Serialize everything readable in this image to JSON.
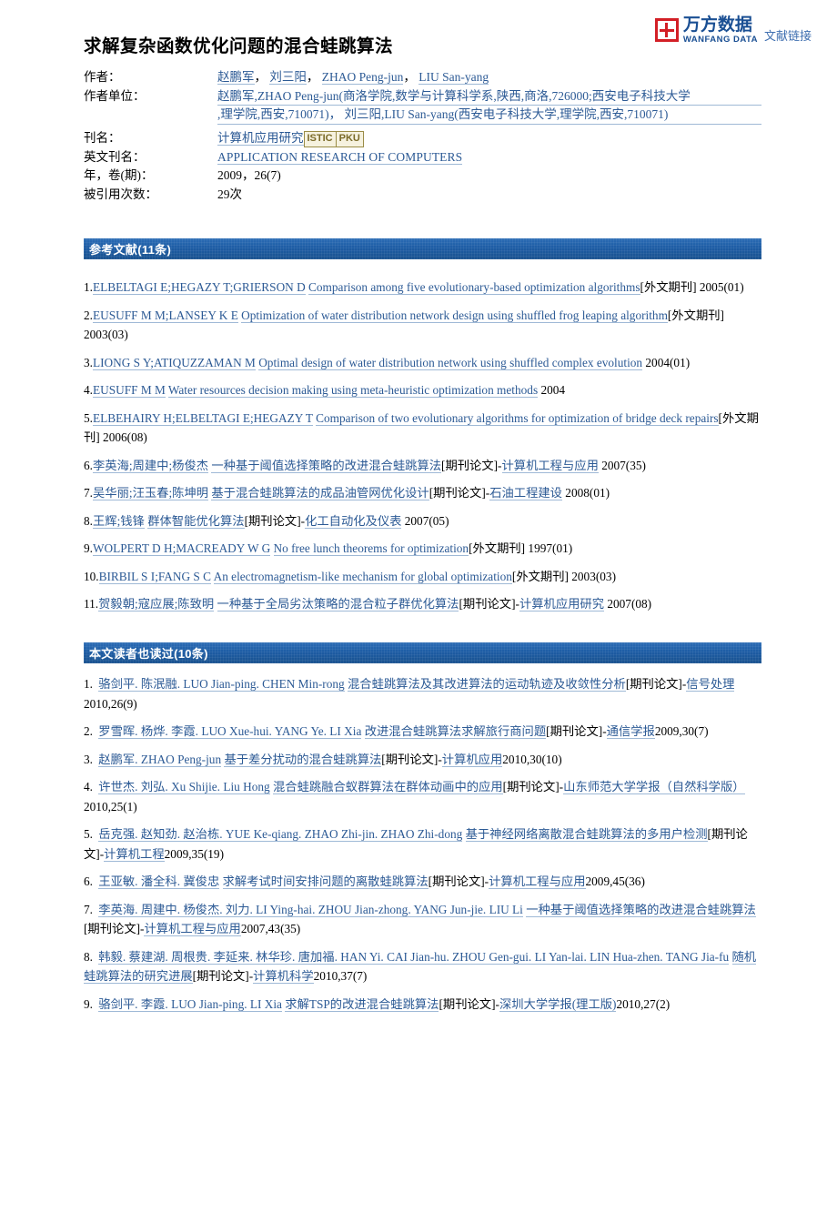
{
  "brand": {
    "name_cn": "万方数据",
    "name_en": "WANFANG DATA",
    "link_label": "文献链接",
    "mark_color": "#d31f26",
    "text_color": "#1a4f93"
  },
  "document": {
    "title": "求解复杂函数优化问题的混合蛙跳算法"
  },
  "meta": {
    "authors_label": "作者：",
    "authors": "赵鹏军， 刘三阳， ZHAO Peng-jun， LIU San-yang",
    "authors_list": [
      "赵鹏军",
      "刘三阳",
      "ZHAO Peng-jun",
      "LIU San-yang"
    ],
    "affiliation_label": "作者单位：",
    "affiliation_line1": "赵鹏军,ZHAO Peng-jun(商洛学院,数学与计算科学系,陕西,商洛,726000;西安电子科技大学",
    "affiliation_line2": ",理学院,西安,710071)， 刘三阳,LIU San-yang(西安电子科技大学,理学院,西安,710071)",
    "journal_label": "刊名：",
    "journal": "计算机应用研究",
    "journal_badges": [
      "ISTIC",
      "PKU"
    ],
    "journal_en_label": "英文刊名：",
    "journal_en": "APPLICATION RESEARCH OF COMPUTERS",
    "year_volume_label": "年，卷(期)：",
    "year_volume": "2009，26(7)",
    "citations_label": "被引用次数：",
    "citations": "29次"
  },
  "references_section": {
    "header": "参考文献(11条)",
    "items": [
      {
        "num": "1.",
        "authors": "ELBELTAGI E;HEGAZY T;GRIERSON D",
        "title": "Comparison among five evolutionary-based optimization algorithms",
        "type": "[外文期刊]",
        "journal": "",
        "year": "2005(01)"
      },
      {
        "num": "2.",
        "authors": "EUSUFF M M;LANSEY K E",
        "title": "Optimization of water distribution network design using shuffled frog leaping algorithm",
        "type": "[外文期刊]",
        "journal": "",
        "year": "2003(03)"
      },
      {
        "num": "3.",
        "authors": "LIONG S Y;ATIQUZZAMAN M",
        "title": "Optimal design of water distribution network using shuffled complex evolution",
        "type": "",
        "journal": "",
        "year": "2004(01)"
      },
      {
        "num": "4.",
        "authors": "EUSUFF M M",
        "title": "Water resources decision making using meta-heuristic optimization methods",
        "type": "",
        "journal": "",
        "year": "2004"
      },
      {
        "num": "5.",
        "authors": "ELBEHAIRY H;ELBELTAGI E;HEGAZY T",
        "title": "Comparison of two evolutionary algorithms for optimization of bridge deck repairs",
        "type": "[外文期刊]",
        "journal": "",
        "year": "2006(08)"
      },
      {
        "num": "6.",
        "authors": "李英海;周建中;杨俊杰",
        "title": "一种基于阈值选择策略的改进混合蛙跳算法",
        "type": "[期刊论文]-",
        "journal": "计算机工程与应用",
        "year": "2007(35)"
      },
      {
        "num": "7.",
        "authors": "吴华丽;汪玉春;陈坤明",
        "title": "基于混合蛙跳算法的成品油管网优化设计",
        "type": "[期刊论文]-",
        "journal": "石油工程建设",
        "year": "2008(01)"
      },
      {
        "num": "8.",
        "authors": "王辉;钱锋",
        "title": "群体智能优化算法",
        "type": "[期刊论文]-",
        "journal": "化工自动化及仪表",
        "year": "2007(05)"
      },
      {
        "num": "9.",
        "authors": "WOLPERT D H;MACREADY W G",
        "title": "No free lunch theorems for optimization",
        "type": "[外文期刊]",
        "journal": "",
        "year": "1997(01)"
      },
      {
        "num": "10.",
        "authors": "BIRBIL S I;FANG S C",
        "title": "An electromagnetism-like mechanism for global optimization",
        "type": "[外文期刊]",
        "journal": "",
        "year": "2003(03)"
      },
      {
        "num": "11.",
        "authors": "贺毅朝;寇应展;陈致明",
        "title": "一种基于全局劣汰策略的混合粒子群优化算法",
        "type": "[期刊论文]-",
        "journal": "计算机应用研究",
        "year": "2007(08)"
      }
    ]
  },
  "also_read_section": {
    "header": "本文读者也读过(10条)",
    "items": [
      {
        "num": "1.",
        "authors": "骆剑平. 陈泯融. LUO Jian-ping. CHEN Min-rong",
        "title": "混合蛙跳算法及其改进算法的运动轨迹及收敛性分析",
        "type": "[期刊论文]-",
        "journal": "信号处理",
        "year": "2010,26(9)"
      },
      {
        "num": "2.",
        "authors": "罗雪晖. 杨烨. 李霞. LUO Xue-hui. YANG Ye. LI Xia",
        "title": "改进混合蛙跳算法求解旅行商问题",
        "type": "[期刊论文]-",
        "journal": "通信学报",
        "year": "2009,30(7)"
      },
      {
        "num": "3.",
        "authors": "赵鹏军. ZHAO Peng-jun",
        "title": "基于差分扰动的混合蛙跳算法",
        "type": "[期刊论文]-",
        "journal": "计算机应用",
        "year": "2010,30(10)"
      },
      {
        "num": "4.",
        "authors": "许世杰. 刘弘. Xu Shijie. Liu Hong",
        "title": "混合蛙跳融合蚁群算法在群体动画中的应用",
        "type": "[期刊论文]-",
        "journal": "山东师范大学学报（自然科学版）",
        "year": "2010,25(1)"
      },
      {
        "num": "5.",
        "authors": "岳克强. 赵知劲. 赵治栋. YUE Ke-qiang. ZHAO Zhi-jin. ZHAO Zhi-dong",
        "title": "基于神经网络离散混合蛙跳算法的多用户检测",
        "type": "[期刊论文]-",
        "journal": "计算机工程",
        "year": "2009,35(19)"
      },
      {
        "num": "6.",
        "authors": "王亚敏. 潘全科. 冀俊忠",
        "title": "求解考试时间安排问题的离散蛙跳算法",
        "type": "[期刊论文]-",
        "journal": "计算机工程与应用",
        "year": "2009,45(36)"
      },
      {
        "num": "7.",
        "authors": "李英海. 周建中. 杨俊杰. 刘力. LI Ying-hai. ZHOU Jian-zhong. YANG Jun-jie. LIU Li",
        "title": "一种基于阈值选择策略的改进混合蛙跳算法",
        "type": "[期刊论文]-",
        "journal": "计算机工程与应用",
        "year": "2007,43(35)"
      },
      {
        "num": "8.",
        "authors": "韩毅. 蔡建湖. 周根贵. 李延来. 林华珍. 唐加福. HAN Yi. CAI Jian-hu. ZHOU Gen-gui. LI Yan-lai. LIN Hua-zhen. TANG Jia-fu",
        "title": "随机蛙跳算法的研究进展",
        "type": "[期刊论文]-",
        "journal": "计算机科学",
        "year": "2010,37(7)"
      },
      {
        "num": "9.",
        "authors": "骆剑平. 李霞. LUO Jian-ping. LI Xia",
        "title": "求解TSP的改进混合蛙跳算法",
        "type": "[期刊论文]-",
        "journal": "深圳大学学报(理工版)",
        "year": "2010,27(2)"
      }
    ]
  },
  "colors": {
    "link": "#2c5a95",
    "section_bar": "#1d5ca4",
    "badge_text": "#7a6a28",
    "badge_bg": "#f6f2df",
    "badge_border": "#9a8c46"
  }
}
